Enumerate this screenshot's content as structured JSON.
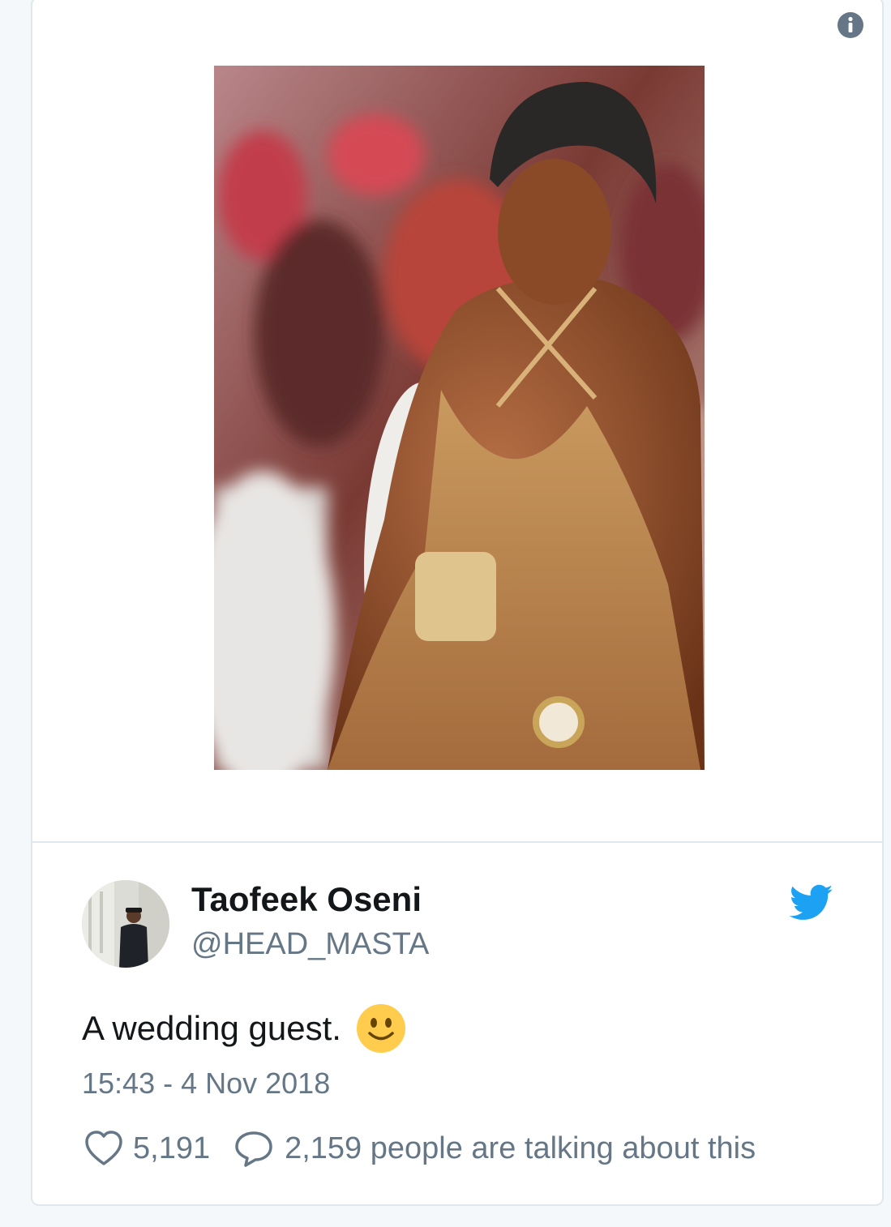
{
  "tweet": {
    "author": {
      "display_name": "Taofeek Oseni",
      "handle": "@HEAD_MASTA"
    },
    "text": "A wedding guest.",
    "emoji": "slightly-smiling-face",
    "timestamp": "15:43 - 4 Nov 2018",
    "likes": "5,191",
    "talking": "2,159 people are talking about this"
  },
  "icons": {
    "info": "info-icon",
    "brand": "twitter-bird-icon",
    "like": "heart-icon",
    "reply": "speech-bubble-icon"
  },
  "colors": {
    "twitter_blue": "#1da1f2",
    "text_primary": "#14171a",
    "text_secondary": "#657786",
    "border": "#e1e8ed"
  }
}
